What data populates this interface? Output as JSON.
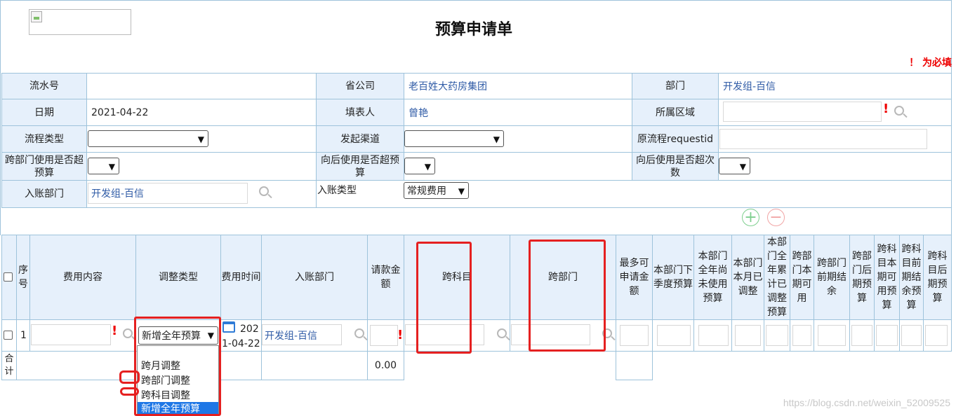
{
  "form": {
    "title": "预算申请单",
    "required_note": "！ 为必填"
  },
  "header_fields": {
    "serial_label": "流水号",
    "serial_value": "",
    "province_label": "省公司",
    "province_value": "老百姓大药房集团",
    "dept_label": "部门",
    "dept_value": "开发组-百信",
    "date_label": "日期",
    "date_value": "2021-04-22",
    "filler_label": "填表人",
    "filler_value": "曾艳",
    "region_label": "所属区域",
    "flow_type_label": "流程类型",
    "channel_label": "发起渠道",
    "orig_req_label": "原流程requestid",
    "cross_dept_over_label": "跨部门使用是否超预算",
    "backward_over_label": "向后使用是否超预算",
    "backward_times_label": "向后使用是否超次数",
    "entry_dept_label": "入账部门",
    "entry_dept_value": "开发组-百信",
    "entry_type_label": "入账类型",
    "entry_type_value": "常规费用"
  },
  "detail_columns": [
    "序号",
    "费用内容",
    "调整类型",
    "费用时间",
    "入账部门",
    "请款金额",
    "跨科目",
    "跨部门",
    "最多可申请金额",
    "本部门下季度预算",
    "本部门全年尚未使用预算",
    "本部门本月已调整",
    "本部门全年累计已调整预算",
    "跨部门本期可用",
    "跨部门前期结余",
    "跨部门后期预算",
    "跨科目本期可用预算",
    "跨科目前期结余预算",
    "跨科目后期预算"
  ],
  "detail_row": {
    "index": "1",
    "adjust_type": "新增全年预算",
    "time_part1": "202",
    "time_part2": "1-04-22",
    "entry_dept": "开发组-百信"
  },
  "total": {
    "label": "合计",
    "amount": "0.00"
  },
  "dropdown_options": [
    "跨月调整",
    "跨部门调整",
    "跨科目调整",
    "新增全年预算"
  ],
  "buttons": {
    "add": "+",
    "remove": "−"
  },
  "watermark": "https://blog.csdn.net/weixin_52009525",
  "colors": {
    "label_bg": "#e6f0fb",
    "border": "#9ec3db",
    "required": "#e00000",
    "highlight": "#e52020",
    "link": "#2f5ba6",
    "selected": "#1e77e6"
  }
}
